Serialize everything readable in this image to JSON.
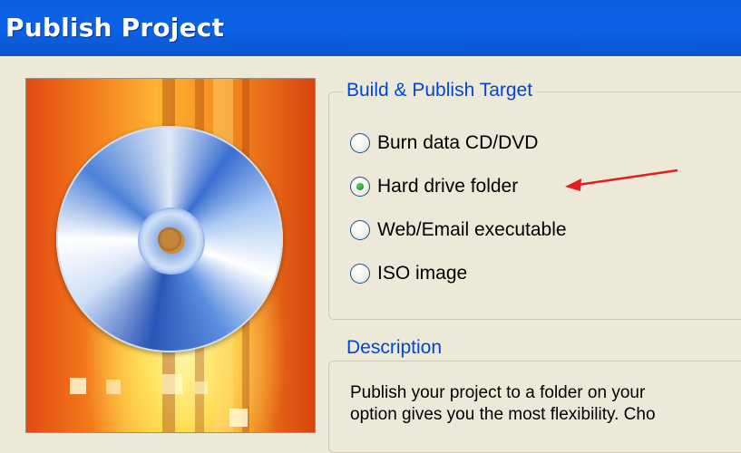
{
  "window": {
    "title": "Publish Project"
  },
  "build_target": {
    "legend": "Build & Publish Target",
    "options": [
      {
        "label": "Burn data CD/DVD",
        "checked": false
      },
      {
        "label": "Hard drive folder",
        "checked": true
      },
      {
        "label": "Web/Email executable",
        "checked": false
      },
      {
        "label": "ISO image",
        "checked": false
      }
    ]
  },
  "description": {
    "legend": "Description",
    "lines": [
      "Publish your project to a folder on your",
      "option gives you the most flexibility. Cho"
    ]
  },
  "annotation": {
    "arrow_color": "#e02020"
  },
  "side_art": {
    "icon": "cd-disc-icon"
  }
}
